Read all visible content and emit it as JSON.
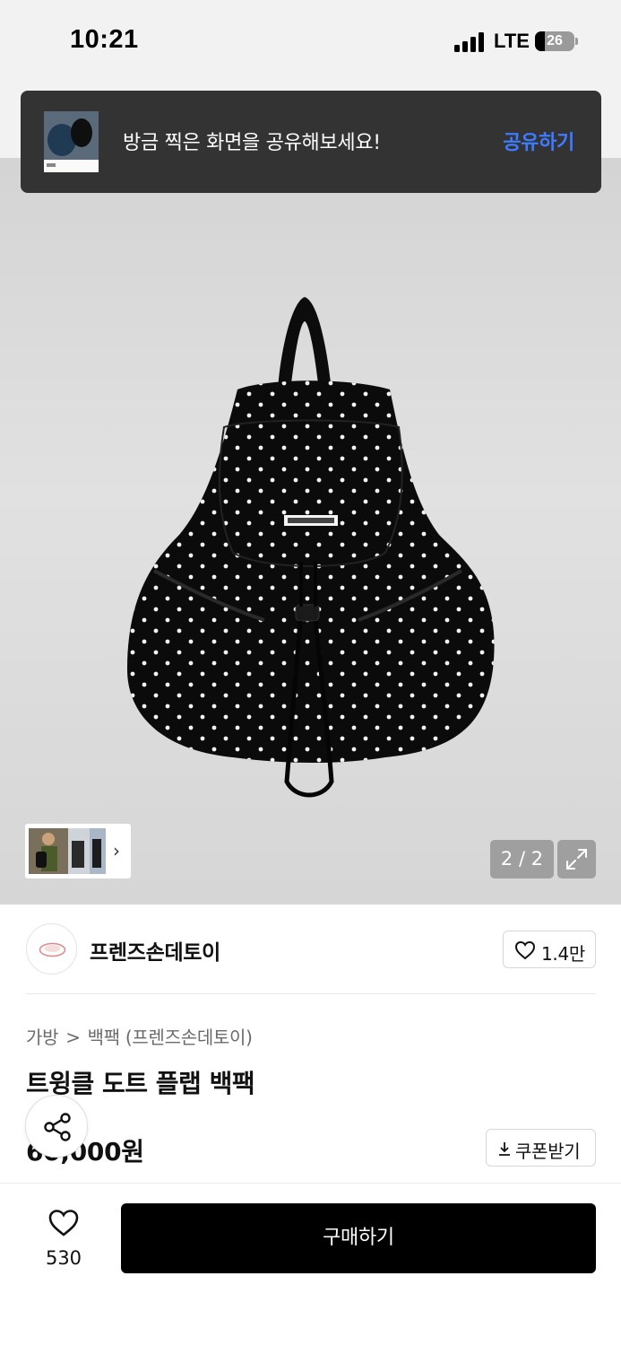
{
  "status_bar": {
    "time": "10:21",
    "network": "LTE",
    "battery_level": "26",
    "battery_fraction": 0.26
  },
  "toast": {
    "message": "방금 찍은 화면을 공유해보세요!",
    "action": "공유하기",
    "action_color": "#3d7bff"
  },
  "gallery": {
    "pager": "2 / 2",
    "thumb_chevron": "›",
    "expand_icon": "expand-icon"
  },
  "brand": {
    "name": "프렌즈손데토이",
    "likes": "1.4만",
    "logo_icon": "brand-logo"
  },
  "product": {
    "breadcrumb": [
      "가방",
      "백팩 (프렌즈손데토이)"
    ],
    "breadcrumb_separator": ">",
    "title": "트윙클 도트 플랩 백팩",
    "price": "60,000원",
    "coupon_label": "쿠폰받기"
  },
  "bottom_bar": {
    "wish_count": "530",
    "buy_label": "구매하기",
    "buy_color": "#000000"
  }
}
